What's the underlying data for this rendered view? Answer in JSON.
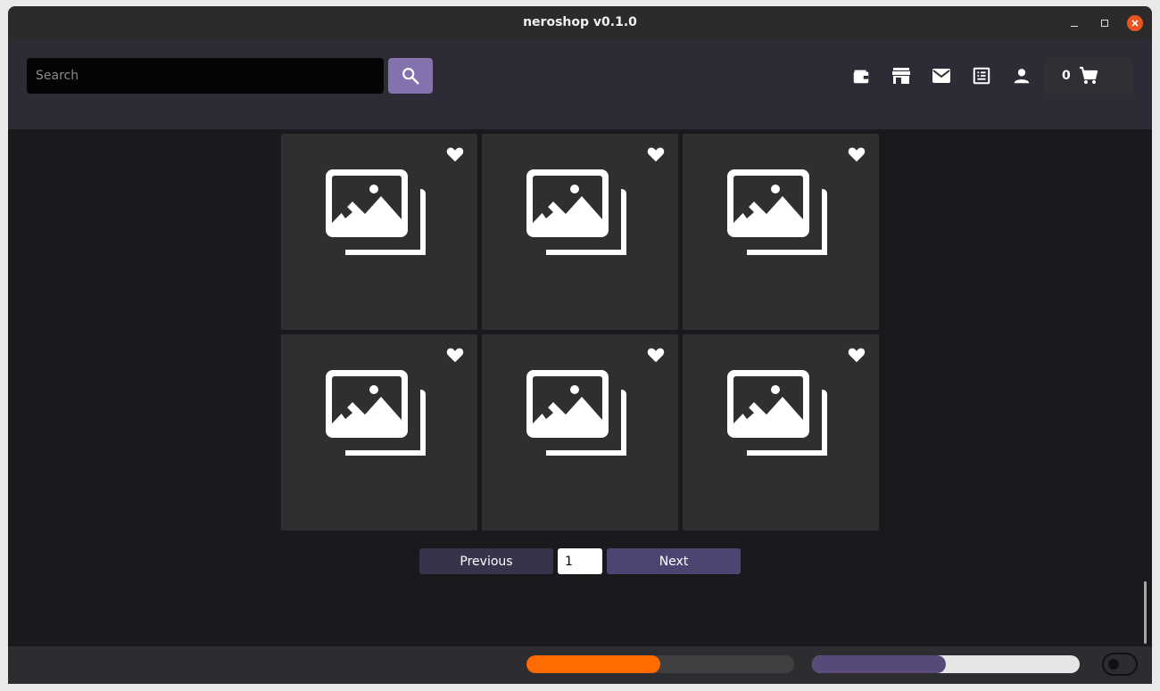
{
  "window": {
    "title": "neroshop v0.1.0"
  },
  "header": {
    "search_placeholder": "Search",
    "icons": [
      "wallet-icon",
      "store-icon",
      "mail-icon",
      "orders-icon",
      "account-icon"
    ],
    "cart": {
      "count": "0",
      "icon": "shopping-cart-icon"
    }
  },
  "products": [
    {
      "favorite_icon": "heart-icon",
      "image_icon": "image-placeholder-icon"
    },
    {
      "favorite_icon": "heart-icon",
      "image_icon": "image-placeholder-icon"
    },
    {
      "favorite_icon": "heart-icon",
      "image_icon": "image-placeholder-icon"
    },
    {
      "favorite_icon": "heart-icon",
      "image_icon": "image-placeholder-icon"
    },
    {
      "favorite_icon": "heart-icon",
      "image_icon": "image-placeholder-icon"
    },
    {
      "favorite_icon": "heart-icon",
      "image_icon": "image-placeholder-icon"
    }
  ],
  "pagination": {
    "previous_label": "Previous",
    "page": "1",
    "next_label": "Next"
  },
  "status": {
    "progress_one": {
      "value": 0.5,
      "color": "#ff6b00"
    },
    "progress_two": {
      "value": 0.5,
      "color": "#574a7a"
    }
  },
  "colors": {
    "accent": "#8372ae",
    "next_button": "#4e4472",
    "prev_button": "#37334b"
  }
}
